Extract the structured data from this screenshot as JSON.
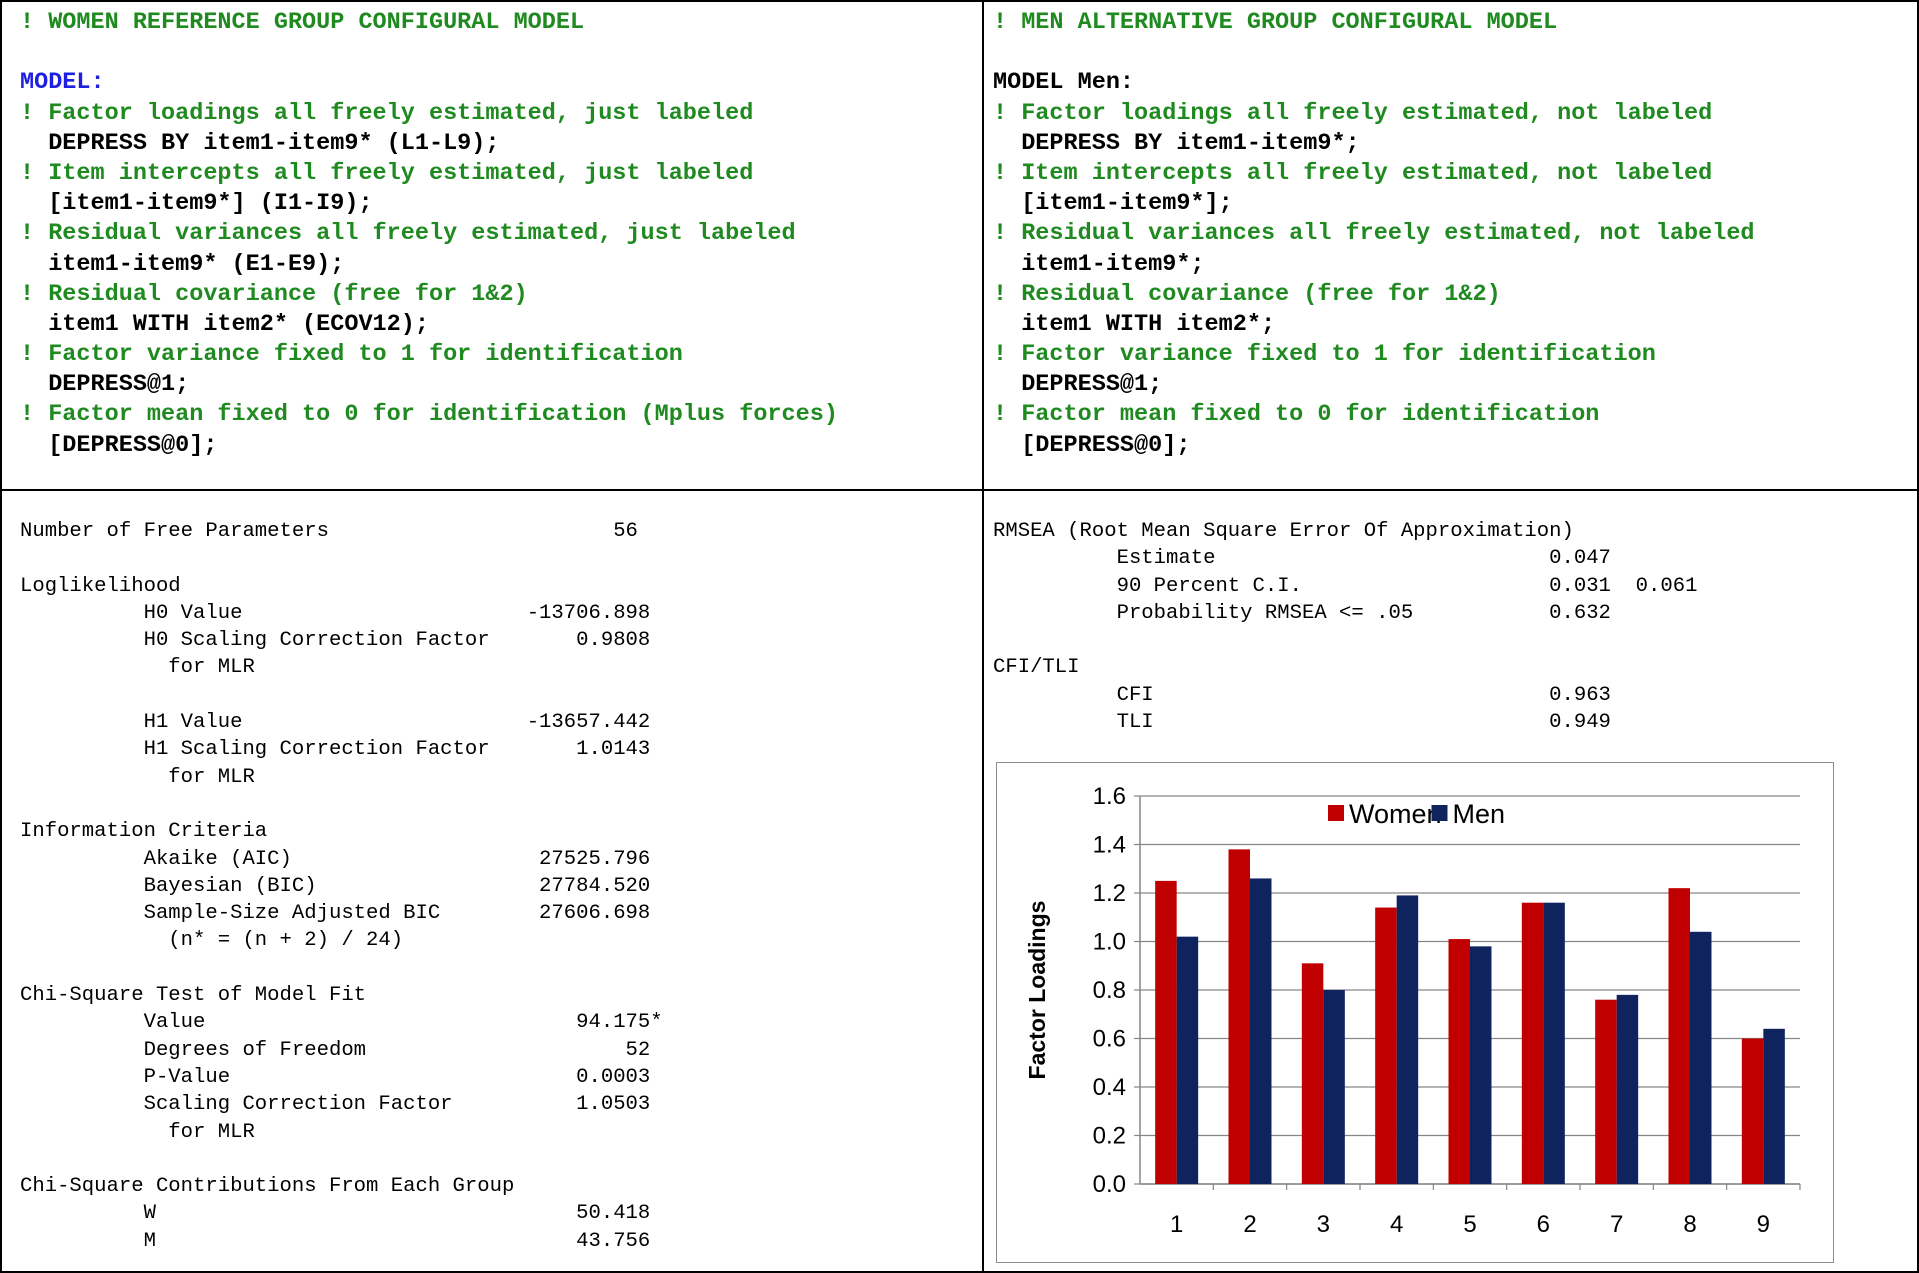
{
  "women_code": [
    {
      "text": "! WOMEN REFERENCE GROUP CONFIGURAL MODEL",
      "color": "green"
    },
    {
      "text": "",
      "color": "black"
    },
    {
      "text": "MODEL:",
      "color": "blue"
    },
    {
      "text": "! Factor loadings all freely estimated, just labeled",
      "color": "green"
    },
    {
      "text": "  DEPRESS BY item1-item9* (L1-L9);",
      "color": "black"
    },
    {
      "text": "! Item intercepts all freely estimated, just labeled",
      "color": "green"
    },
    {
      "text": "  [item1-item9*] (I1-I9);",
      "color": "black"
    },
    {
      "text": "! Residual variances all freely estimated, just labeled",
      "color": "green"
    },
    {
      "text": "  item1-item9* (E1-E9);",
      "color": "black"
    },
    {
      "text": "! Residual covariance (free for 1&2)",
      "color": "green"
    },
    {
      "text": "  item1 WITH item2* (ECOV12);",
      "color": "black"
    },
    {
      "text": "! Factor variance fixed to 1 for identification",
      "color": "green"
    },
    {
      "text": "  DEPRESS@1;",
      "color": "black"
    },
    {
      "text": "! Factor mean fixed to 0 for identification (Mplus forces)",
      "color": "green"
    },
    {
      "text": "  [DEPRESS@0];",
      "color": "black"
    }
  ],
  "men_code": [
    {
      "text": "! MEN ALTERNATIVE GROUP CONFIGURAL MODEL",
      "color": "green"
    },
    {
      "text": "",
      "color": "black"
    },
    {
      "text": "MODEL Men:",
      "color": "black"
    },
    {
      "text": "! Factor loadings all freely estimated, not labeled",
      "color": "green"
    },
    {
      "text": "  DEPRESS BY item1-item9*;",
      "color": "black"
    },
    {
      "text": "! Item intercepts all freely estimated, not labeled",
      "color": "green"
    },
    {
      "text": "  [item1-item9*];",
      "color": "black"
    },
    {
      "text": "! Residual variances all freely estimated, not labeled",
      "color": "green"
    },
    {
      "text": "  item1-item9*;",
      "color": "black"
    },
    {
      "text": "! Residual covariance (free for 1&2)",
      "color": "green"
    },
    {
      "text": "  item1 WITH item2*;",
      "color": "black"
    },
    {
      "text": "! Factor variance fixed to 1 for identification",
      "color": "green"
    },
    {
      "text": "  DEPRESS@1;",
      "color": "black"
    },
    {
      "text": "! Factor mean fixed to 0 for identification",
      "color": "green"
    },
    {
      "text": "  [DEPRESS@0];",
      "color": "black"
    }
  ],
  "fit_output_left": [
    "Number of Free Parameters                       56",
    "",
    "Loglikelihood",
    "          H0 Value                       -13706.898",
    "          H0 Scaling Correction Factor       0.9808",
    "            for MLR",
    "",
    "          H1 Value                       -13657.442",
    "          H1 Scaling Correction Factor       1.0143",
    "            for MLR",
    "",
    "Information Criteria",
    "          Akaike (AIC)                    27525.796",
    "          Bayesian (BIC)                  27784.520",
    "          Sample-Size Adjusted BIC        27606.698",
    "            (n* = (n + 2) / 24)",
    "",
    "Chi-Square Test of Model Fit",
    "          Value                              94.175*",
    "          Degrees of Freedom                     52",
    "          P-Value                            0.0003",
    "          Scaling Correction Factor          1.0503",
    "            for MLR",
    "",
    "Chi-Square Contributions From Each Group",
    "          W                                  50.418",
    "          M                                  43.756"
  ],
  "fit_output_right": [
    "RMSEA (Root Mean Square Error Of Approximation)",
    "          Estimate                           0.047",
    "          90 Percent C.I.                    0.031  0.061",
    "          Probability RMSEA <= .05           0.632",
    "",
    "CFI/TLI",
    "          CFI                                0.963",
    "          TLI                                0.949"
  ],
  "chart_data": {
    "type": "bar",
    "categories": [
      "1",
      "2",
      "3",
      "4",
      "5",
      "6",
      "7",
      "8",
      "9"
    ],
    "series": [
      {
        "name": "Women",
        "color": "#c00000",
        "values": [
          1.25,
          1.38,
          0.91,
          1.14,
          1.01,
          1.16,
          0.76,
          1.22,
          0.6
        ]
      },
      {
        "name": "Men",
        "color": "#0f245f",
        "values": [
          1.02,
          1.26,
          0.8,
          1.19,
          0.98,
          1.16,
          0.78,
          1.04,
          0.64
        ]
      }
    ],
    "ylabel": "Factor Loadings",
    "xlabel": "",
    "ylim": [
      0.0,
      1.6
    ],
    "yticks": [
      "0.0",
      "0.2",
      "0.4",
      "0.6",
      "0.8",
      "1.0",
      "1.2",
      "1.4",
      "1.6"
    ],
    "grid": true,
    "legend_position": "top"
  }
}
